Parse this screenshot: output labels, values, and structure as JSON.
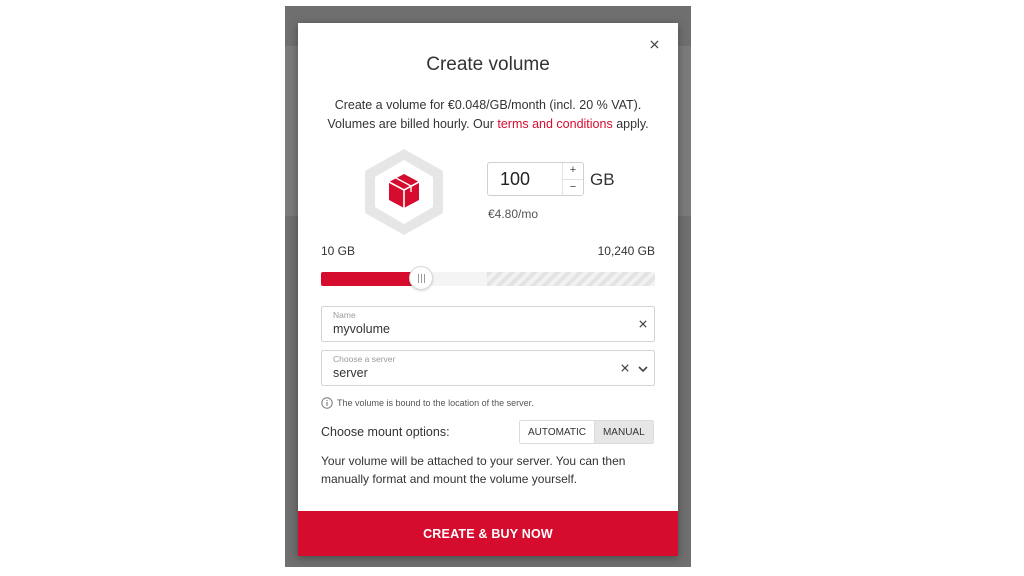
{
  "dialog": {
    "title": "Create volume",
    "intro_line1": "Create a volume for €0.048/GB/month (incl. 20 % VAT).",
    "intro_line2_before": "Volumes are billed hourly. Our ",
    "terms_link": "terms and conditions",
    "intro_line2_after": " apply.",
    "close_icon": "close-icon"
  },
  "size": {
    "value": "100",
    "unit": "GB",
    "increment_label": "+",
    "decrement_label": "−",
    "price": "€4.80/mo"
  },
  "slider": {
    "min_label": "10 GB",
    "max_label": "10,240 GB",
    "fill_fraction": 0.3
  },
  "name_field": {
    "label": "Name",
    "value": "myvolume"
  },
  "server_field": {
    "label": "Choose a server",
    "value": "server"
  },
  "note": "The volume is bound to the location of the server.",
  "mount": {
    "label": "Choose mount options:",
    "options": [
      "AUTOMATIC",
      "MANUAL"
    ],
    "selected": "MANUAL",
    "description_line1": "Your volume will be attached to your server. You can then",
    "description_line2": "manually format and mount the volume yourself."
  },
  "cta_label": "CREATE & BUY NOW",
  "colors": {
    "accent": "#d50c2d",
    "backdrop": "#6f6f6f"
  }
}
